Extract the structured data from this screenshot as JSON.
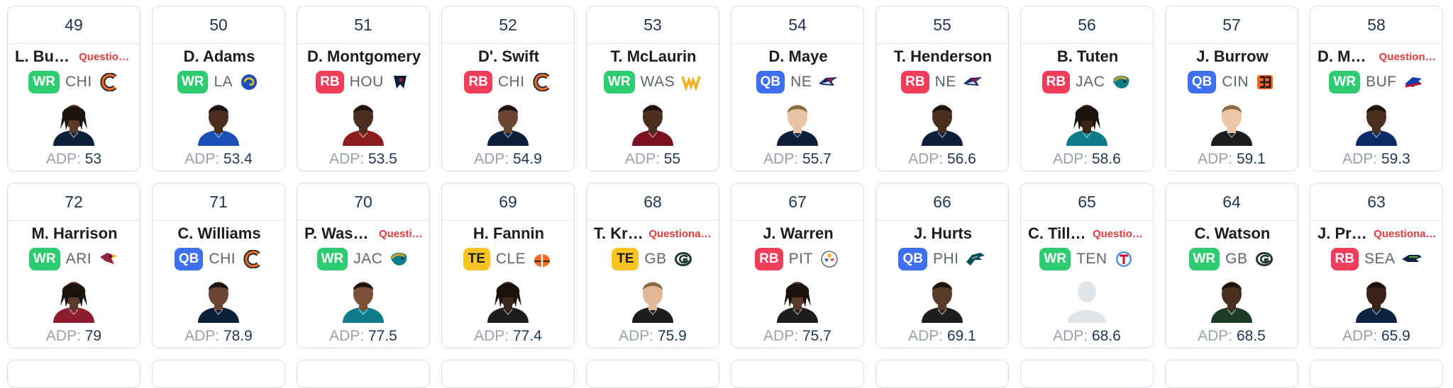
{
  "adp_label": "ADP:",
  "colors": {
    "WR": "#2ecc71",
    "RB": "#ef3d5a",
    "QB": "#3f6ff1",
    "TE": "#f7c423",
    "status": "#e23b3b",
    "card_border": "#d9dde3"
  },
  "rows": [
    {
      "cards": [
        {
          "pick": "49",
          "name": "L. Burden",
          "status": "Questionable",
          "pos": "WR",
          "team": "CHI",
          "team_icon": "bears-logo-icon",
          "adp": "53",
          "skin": "#5a3a28",
          "jersey": "#0b1f3a",
          "hair": "dreads"
        },
        {
          "pick": "50",
          "name": "D. Adams",
          "status": "",
          "pos": "WR",
          "team": "LA",
          "team_icon": "rams-logo-icon",
          "adp": "53.4",
          "skin": "#4a2f21",
          "jersey": "#1a4fb5",
          "hair": "short"
        },
        {
          "pick": "51",
          "name": "D. Montgomery",
          "status": "",
          "pos": "RB",
          "team": "HOU",
          "team_icon": "texans-logo-icon",
          "adp": "53.5",
          "skin": "#4b2e20",
          "jersey": "#8b1d1d",
          "hair": "short"
        },
        {
          "pick": "52",
          "name": "D'. Swift",
          "status": "",
          "pos": "RB",
          "team": "CHI",
          "team_icon": "bears-logo-icon",
          "adp": "54.9",
          "skin": "#6b4632",
          "jersey": "#0b1f3a",
          "hair": "short"
        },
        {
          "pick": "53",
          "name": "T. McLaurin",
          "status": "",
          "pos": "WR",
          "team": "WAS",
          "team_icon": "commanders-logo-icon",
          "adp": "55",
          "skin": "#4a2f21",
          "jersey": "#7a1020",
          "hair": "short"
        },
        {
          "pick": "54",
          "name": "D. Maye",
          "status": "",
          "pos": "QB",
          "team": "NE",
          "team_icon": "patriots-logo-icon",
          "adp": "55.7",
          "skin": "#e8c4a4",
          "jersey": "#0b1f3a",
          "hair": "light"
        },
        {
          "pick": "55",
          "name": "T. Henderson",
          "status": "",
          "pos": "RB",
          "team": "NE",
          "team_icon": "patriots-logo-icon",
          "adp": "56.6",
          "skin": "#4a2f21",
          "jersey": "#0b1f3a",
          "hair": "short"
        },
        {
          "pick": "56",
          "name": "B. Tuten",
          "status": "",
          "pos": "RB",
          "team": "JAC",
          "team_icon": "jaguars-logo-icon",
          "adp": "58.6",
          "skin": "#3a2418",
          "jersey": "#0f7c8a",
          "hair": "dreads"
        },
        {
          "pick": "57",
          "name": "J. Burrow",
          "status": "",
          "pos": "QB",
          "team": "CIN",
          "team_icon": "bengals-logo-icon",
          "adp": "59.1",
          "skin": "#eac7a6",
          "jersey": "#1d1d1f",
          "hair": "light"
        },
        {
          "pick": "58",
          "name": "D. Moore",
          "status": "Questionable",
          "pos": "WR",
          "team": "BUF",
          "team_icon": "bills-logo-icon",
          "adp": "59.3",
          "skin": "#4a2f21",
          "jersey": "#0b2a66",
          "hair": "short"
        }
      ]
    },
    {
      "cards": [
        {
          "pick": "72",
          "name": "M. Harrison",
          "status": "",
          "pos": "WR",
          "team": "ARI",
          "team_icon": "cardinals-logo-icon",
          "adp": "79",
          "skin": "#5a3a28",
          "jersey": "#8b1d2c",
          "hair": "dreads"
        },
        {
          "pick": "71",
          "name": "C. Williams",
          "status": "",
          "pos": "QB",
          "team": "CHI",
          "team_icon": "bears-logo-icon",
          "adp": "78.9",
          "skin": "#6b4632",
          "jersey": "#0b1f3a",
          "hair": "short"
        },
        {
          "pick": "70",
          "name": "P. Washington",
          "status": "Questionable",
          "pos": "WR",
          "team": "JAC",
          "team_icon": "jaguars-logo-icon",
          "adp": "77.5",
          "skin": "#7a5038",
          "jersey": "#0f7c8a",
          "hair": "short"
        },
        {
          "pick": "69",
          "name": "H. Fannin",
          "status": "",
          "pos": "TE",
          "team": "CLE",
          "team_icon": "browns-logo-icon",
          "adp": "77.4",
          "skin": "#3e271b",
          "jersey": "#1d1d1f",
          "hair": "dreads"
        },
        {
          "pick": "68",
          "name": "T. Kraft",
          "status": "Questionable",
          "pos": "TE",
          "team": "GB",
          "team_icon": "packers-logo-icon",
          "adp": "75.9",
          "skin": "#e0b898",
          "jersey": "#1d1d1f",
          "hair": "light"
        },
        {
          "pick": "67",
          "name": "J. Warren",
          "status": "",
          "pos": "RB",
          "team": "PIT",
          "team_icon": "steelers-logo-icon",
          "adp": "75.7",
          "skin": "#5a3a28",
          "jersey": "#1d1d1f",
          "hair": "dreads"
        },
        {
          "pick": "66",
          "name": "J. Hurts",
          "status": "",
          "pos": "QB",
          "team": "PHI",
          "team_icon": "eagles-logo-icon",
          "adp": "69.1",
          "skin": "#5a3a28",
          "jersey": "#1d1d1f",
          "hair": "short"
        },
        {
          "pick": "65",
          "name": "C. Tillman",
          "status": "Questionable",
          "pos": "WR",
          "team": "TEN",
          "team_icon": "titans-logo-icon",
          "adp": "68.6",
          "skin": "silhouette",
          "jersey": "#dfe2e6",
          "hair": "none"
        },
        {
          "pick": "64",
          "name": "C. Watson",
          "status": "",
          "pos": "WR",
          "team": "GB",
          "team_icon": "packers-logo-icon",
          "adp": "68.5",
          "skin": "#4a2f21",
          "jersey": "#1d3a24",
          "hair": "short"
        },
        {
          "pick": "63",
          "name": "J. Price",
          "status": "Questionable",
          "pos": "RB",
          "team": "SEA",
          "team_icon": "seahawks-logo-icon",
          "adp": "65.9",
          "skin": "#3a2418",
          "jersey": "#0b2240",
          "hair": "short"
        }
      ]
    }
  ]
}
